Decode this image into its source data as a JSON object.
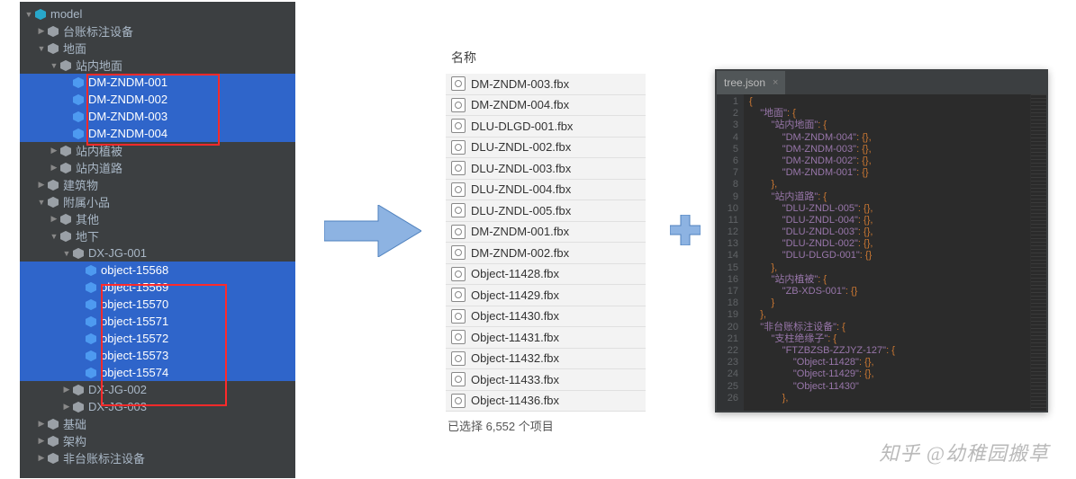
{
  "tree": {
    "root": "model",
    "items": [
      {
        "ind": 0,
        "tw": "down",
        "icon": "root",
        "label": "model"
      },
      {
        "ind": 1,
        "tw": "right",
        "icon": "grey",
        "label": "台账标注设备"
      },
      {
        "ind": 1,
        "tw": "down",
        "icon": "grey",
        "label": "地面"
      },
      {
        "ind": 2,
        "tw": "down",
        "icon": "grey",
        "label": "站内地面"
      },
      {
        "ind": 3,
        "tw": "",
        "icon": "blue",
        "label": "DM-ZNDM-001",
        "sel": true
      },
      {
        "ind": 3,
        "tw": "",
        "icon": "blue",
        "label": "DM-ZNDM-002",
        "sel": true
      },
      {
        "ind": 3,
        "tw": "",
        "icon": "blue",
        "label": "DM-ZNDM-003",
        "sel": true
      },
      {
        "ind": 3,
        "tw": "",
        "icon": "blue",
        "label": "DM-ZNDM-004",
        "sel": true
      },
      {
        "ind": 2,
        "tw": "right",
        "icon": "grey",
        "label": "站内植被"
      },
      {
        "ind": 2,
        "tw": "right",
        "icon": "grey",
        "label": "站内道路"
      },
      {
        "ind": 1,
        "tw": "right",
        "icon": "grey",
        "label": "建筑物"
      },
      {
        "ind": 1,
        "tw": "down",
        "icon": "grey",
        "label": "附属小品"
      },
      {
        "ind": 2,
        "tw": "right",
        "icon": "grey",
        "label": "其他"
      },
      {
        "ind": 2,
        "tw": "down",
        "icon": "grey",
        "label": "地下"
      },
      {
        "ind": 3,
        "tw": "down",
        "icon": "grey",
        "label": "DX-JG-001"
      },
      {
        "ind": 4,
        "tw": "",
        "icon": "blue",
        "label": "object-15568",
        "sel": true
      },
      {
        "ind": 4,
        "tw": "",
        "icon": "blue",
        "label": "object-15569",
        "sel": true
      },
      {
        "ind": 4,
        "tw": "",
        "icon": "blue",
        "label": "object-15570",
        "sel": true
      },
      {
        "ind": 4,
        "tw": "",
        "icon": "blue",
        "label": "object-15571",
        "sel": true
      },
      {
        "ind": 4,
        "tw": "",
        "icon": "blue",
        "label": "object-15572",
        "sel": true
      },
      {
        "ind": 4,
        "tw": "",
        "icon": "blue",
        "label": "object-15573",
        "sel": true
      },
      {
        "ind": 4,
        "tw": "",
        "icon": "blue",
        "label": "object-15574",
        "sel": true
      },
      {
        "ind": 3,
        "tw": "right",
        "icon": "grey",
        "label": "DX-JG-002"
      },
      {
        "ind": 3,
        "tw": "right",
        "icon": "grey",
        "label": "DX-JG-003"
      },
      {
        "ind": 1,
        "tw": "right",
        "icon": "grey",
        "label": "基础"
      },
      {
        "ind": 1,
        "tw": "right",
        "icon": "grey",
        "label": "架构"
      },
      {
        "ind": 1,
        "tw": "right",
        "icon": "grey",
        "label": "非台账标注设备"
      }
    ]
  },
  "filelist": {
    "header": "名称",
    "files": [
      "DM-ZNDM-003.fbx",
      "DM-ZNDM-004.fbx",
      "DLU-DLGD-001.fbx",
      "DLU-ZNDL-002.fbx",
      "DLU-ZNDL-003.fbx",
      "DLU-ZNDL-004.fbx",
      "DLU-ZNDL-005.fbx",
      "DM-ZNDM-001.fbx",
      "DM-ZNDM-002.fbx",
      "Object-11428.fbx",
      "Object-11429.fbx",
      "Object-11430.fbx",
      "Object-11431.fbx",
      "Object-11432.fbx",
      "Object-11433.fbx",
      "Object-11436.fbx"
    ],
    "status": "已选择 6,552 个项目"
  },
  "editor": {
    "tab": "tree.json",
    "lines": [
      {
        "n": "1",
        "t": "{"
      },
      {
        "n": "2",
        "t": "    \"地面\": {"
      },
      {
        "n": "3",
        "t": "        \"站内地面\": {"
      },
      {
        "n": "4",
        "t": "            \"DM-ZNDM-004\": {},"
      },
      {
        "n": "5",
        "t": "            \"DM-ZNDM-003\": {},"
      },
      {
        "n": "6",
        "t": "            \"DM-ZNDM-002\": {},"
      },
      {
        "n": "7",
        "t": "            \"DM-ZNDM-001\": {}"
      },
      {
        "n": "8",
        "t": "        },"
      },
      {
        "n": "9",
        "t": "        \"站内道路\": {"
      },
      {
        "n": "10",
        "t": "            \"DLU-ZNDL-005\": {},"
      },
      {
        "n": "11",
        "t": "            \"DLU-ZNDL-004\": {},"
      },
      {
        "n": "12",
        "t": "            \"DLU-ZNDL-003\": {},"
      },
      {
        "n": "13",
        "t": "            \"DLU-ZNDL-002\": {},"
      },
      {
        "n": "14",
        "t": "            \"DLU-DLGD-001\": {}"
      },
      {
        "n": "15",
        "t": "        },"
      },
      {
        "n": "16",
        "t": "        \"站内植被\": {"
      },
      {
        "n": "17",
        "t": "            \"ZB-XDS-001\": {}"
      },
      {
        "n": "18",
        "t": "        }"
      },
      {
        "n": "19",
        "t": "    },"
      },
      {
        "n": "20",
        "t": "    \"非台账标注设备\": {"
      },
      {
        "n": "21",
        "t": "        \"支柱绝缘子\": {"
      },
      {
        "n": "22",
        "t": "            \"FTZBZSB-ZZJYZ-127\": {"
      },
      {
        "n": "23",
        "t": "                \"Object-11428\": {},"
      },
      {
        "n": "24",
        "t": "                \"Object-11429\": {},"
      },
      {
        "n": "25",
        "t": "                \"Object-11430\""
      },
      {
        "n": "26",
        "t": "            },"
      }
    ]
  },
  "watermark": "知乎 @幼稚园搬草",
  "colors": {
    "arrow": "#8db3e2",
    "plus": "#8db3e2"
  }
}
